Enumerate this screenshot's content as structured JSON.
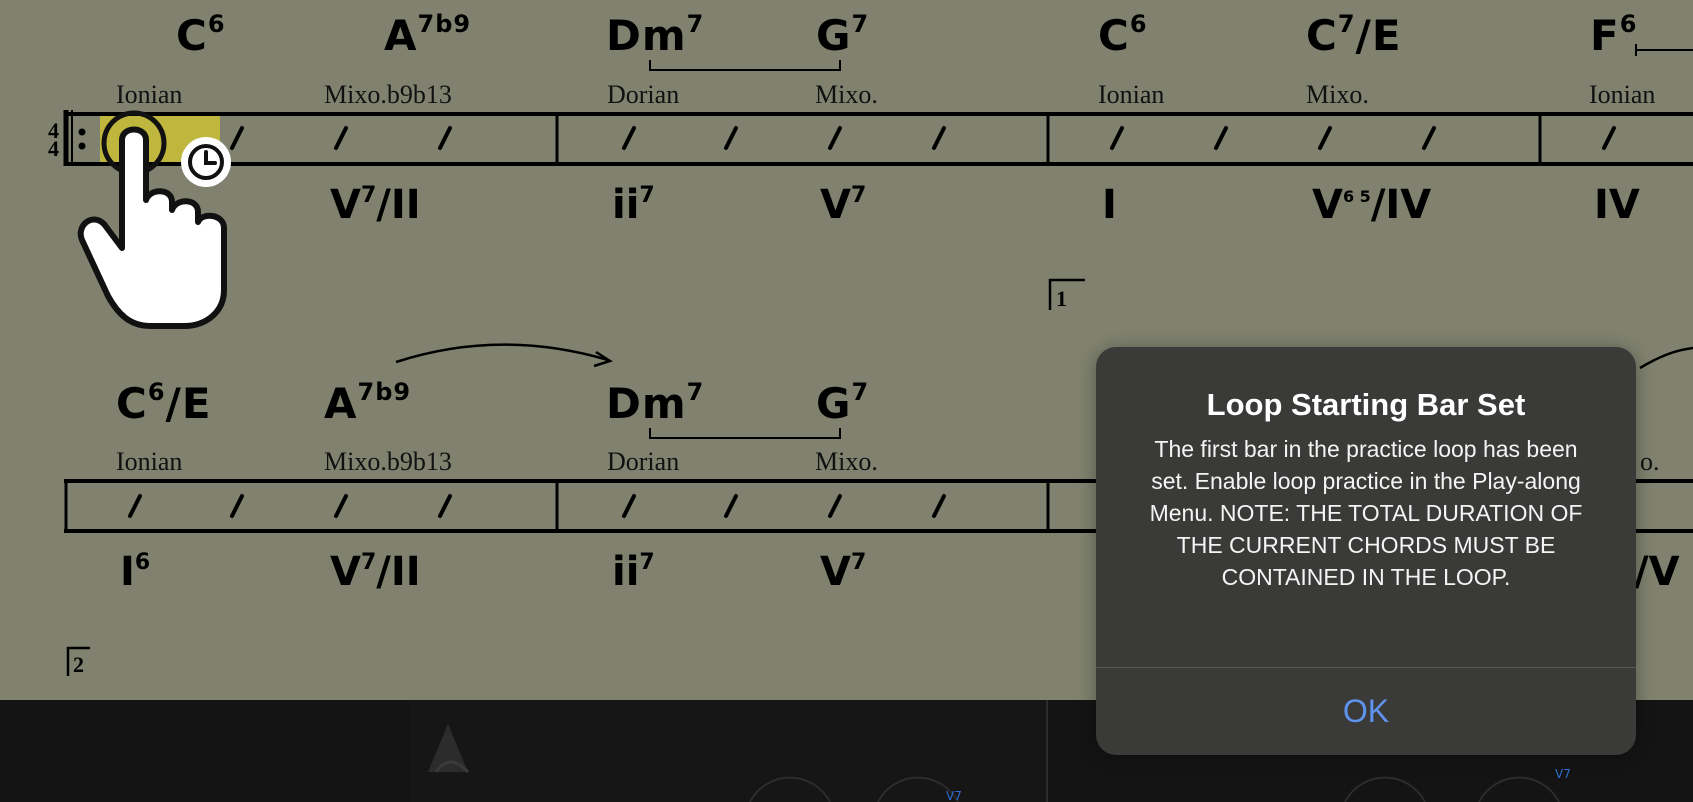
{
  "system1": {
    "chords": [
      {
        "root": "C",
        "ext": "6"
      },
      {
        "root": "A",
        "ext": "7b9"
      },
      {
        "root": "Dm",
        "ext": "7"
      },
      {
        "root": "G",
        "ext": "7"
      },
      {
        "root": "C",
        "ext": "6"
      },
      {
        "root": "C",
        "ext": "7",
        "slash": "/E"
      },
      {
        "root": "F",
        "ext": "6"
      }
    ],
    "scales": [
      "Ionian",
      "Mixo.b9b13",
      "Dorian",
      "Mixo.",
      "Ionian",
      "Mixo.",
      "Ionian"
    ],
    "roman": [
      {
        "main": "V",
        "sup": "7",
        "rest": "/II"
      },
      {
        "main": "ii",
        "sup": "7",
        "rest": ""
      },
      {
        "main": "V",
        "sup": "7",
        "rest": ""
      },
      {
        "main": "I",
        "sup": "",
        "rest": ""
      },
      {
        "main": "V",
        "sup": "6 5",
        "rest": "/IV"
      },
      {
        "main": "IV",
        "sup": "",
        "rest": ""
      }
    ],
    "time_signature": [
      "4",
      "4"
    ],
    "ending_label": "1"
  },
  "system2": {
    "chords": [
      {
        "root": "C",
        "ext": "6",
        "slash": "/E"
      },
      {
        "root": "A",
        "ext": "7b9"
      },
      {
        "root": "Dm",
        "ext": "7"
      },
      {
        "root": "G",
        "ext": "7"
      }
    ],
    "scales": [
      "Ionian",
      "Mixo.b9b13",
      "Dorian",
      "Mixo.",
      "o."
    ],
    "roman": [
      {
        "main": "I",
        "sup": "6",
        "rest": ""
      },
      {
        "main": "V",
        "sup": "7",
        "rest": "/II"
      },
      {
        "main": "ii",
        "sup": "7",
        "rest": ""
      },
      {
        "main": "V",
        "sup": "7",
        "rest": ""
      },
      {
        "main": "/V",
        "sup": "",
        "rest": ""
      }
    ],
    "ending_label": "2"
  },
  "bottom_bar": {
    "small_label_left": "V7",
    "small_label_right": "V7"
  },
  "colors": {
    "score_background": "#80826f",
    "bar_highlight": "#c9c035",
    "dialog_background": "#3a3a38",
    "ok_blue": "#5f94ee"
  },
  "icons": {
    "tap_gesture": "hand-pointer-icon",
    "clock": "clock-icon",
    "logo": "mountain-logo-icon"
  },
  "dialog": {
    "title": "Loop Starting Bar Set",
    "message": "The first bar in the practice loop has been set. Enable loop practice in the Play-along Menu. NOTE: THE TOTAL DURATION OF THE CURRENT CHORDS MUST BE CONTAINED IN THE LOOP.",
    "ok_label": "OK"
  }
}
